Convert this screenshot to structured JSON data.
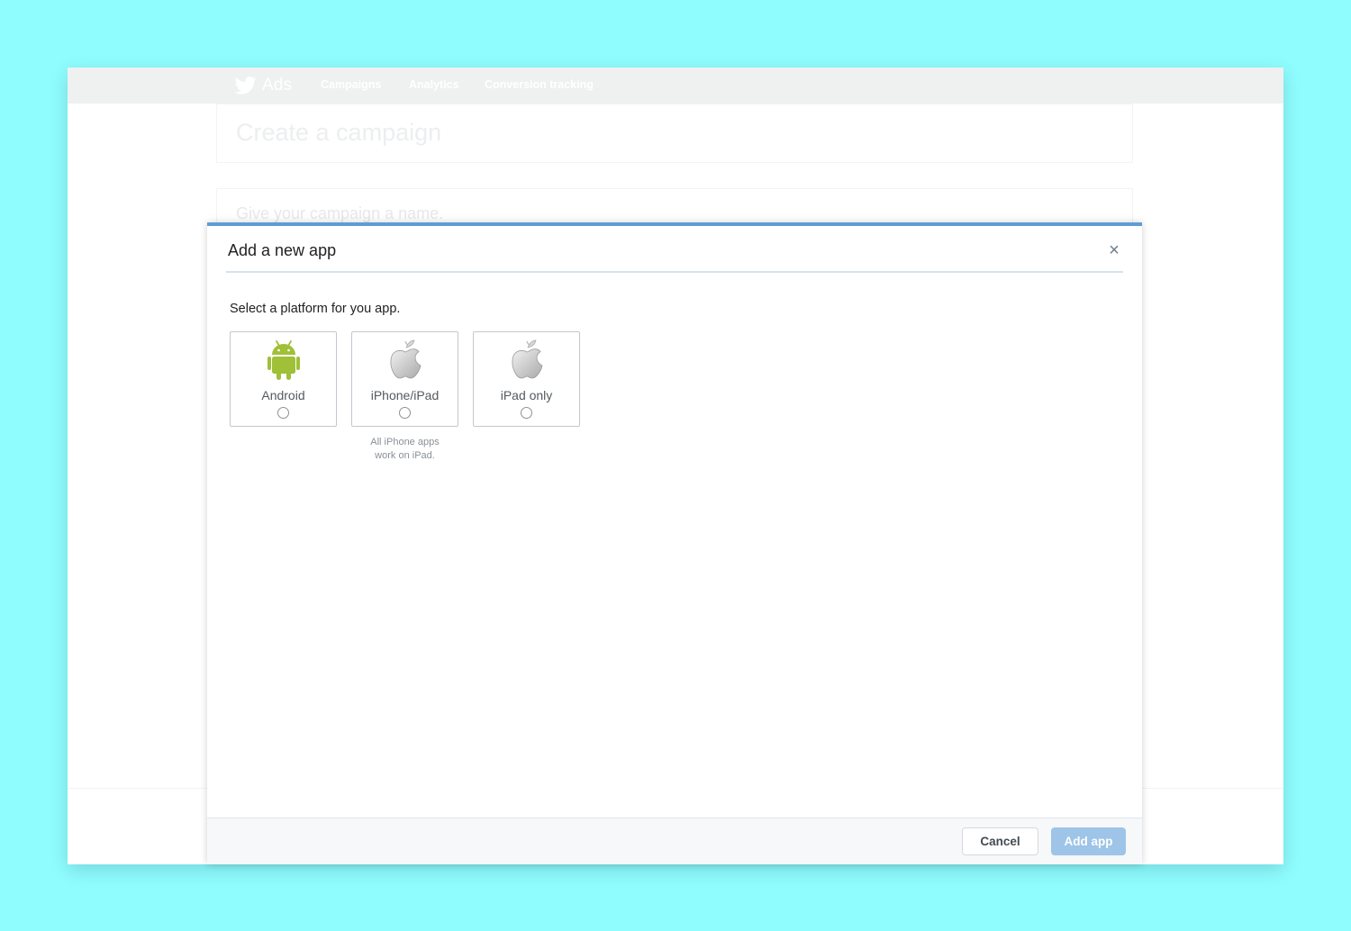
{
  "app": {
    "brand": "Ads",
    "nav": [
      "Campaigns",
      "Analytics",
      "Conversion tracking"
    ]
  },
  "background": {
    "heading": "Create a campaign",
    "name_prompt": "Give your campaign a name."
  },
  "modal": {
    "title": "Add a new app",
    "close_label": "×",
    "prompt": "Select a platform for you app.",
    "platforms": [
      {
        "label": "Android",
        "icon": "android-icon"
      },
      {
        "label": "iPhone/iPad",
        "icon": "apple-icon"
      },
      {
        "label": "iPad only",
        "icon": "apple-icon"
      }
    ],
    "iphone_hint": "All iPhone apps\nwork on iPad.",
    "cancel_label": "Cancel",
    "add_label": "Add app"
  },
  "colors": {
    "page_bg": "#8ffcfe",
    "accent": "#5d9dd6",
    "android_green": "#9fc037",
    "add_button": "#9ec4e8"
  }
}
